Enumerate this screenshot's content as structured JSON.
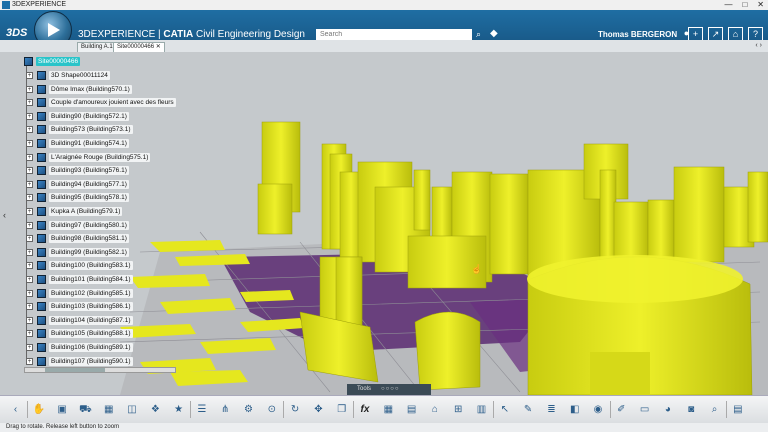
{
  "window": {
    "title": "3DEXPERIENCE",
    "controls": [
      "—",
      "□",
      "✕"
    ]
  },
  "app": {
    "logo": "3DS",
    "brand_prefix": "3DEXPERIENCE",
    "brand_separator": " | ",
    "brand_product": "CATIA",
    "brand_app": " Civil Engineering Design",
    "search_placeholder": "Search",
    "user_name": "Thomas BERGERON",
    "top_icons": [
      "user-icon",
      "add-icon",
      "share-icon",
      "home-icon",
      "help-icon"
    ]
  },
  "tabs": [
    {
      "label": "Building A.1"
    },
    {
      "label": "Site00000466",
      "close": "✕"
    }
  ],
  "tab_nav": "‹ ›",
  "tree": {
    "root": "Site00000466",
    "items": [
      "3D Shape00011124",
      "Dôme Imax (Building570.1)",
      "Couple d'amoureux jouient avec des fleurs",
      "Building90 (Building572.1)",
      "Building573 (Building573.1)",
      "Building91 (Building574.1)",
      "L'Araignée Rouge (Building575.1)",
      "Building93 (Building576.1)",
      "Building94 (Building577.1)",
      "Building95 (Building578.1)",
      "Kupka A (Building579.1)",
      "Building97 (Building580.1)",
      "Building98 (Building581.1)",
      "Building99 (Building582.1)",
      "Building100 (Building583.1)",
      "Building101 (Building584.1)",
      "Building102 (Building585.1)",
      "Building103 (Building586.1)",
      "Building104 (Building587.1)",
      "Building105 (Building588.1)",
      "Building106 (Building589.1)",
      "Building107 (Building590.1)"
    ]
  },
  "viewport": {
    "tools_label": "Tools",
    "tools_dots": "○○○○",
    "collapse_arrow": "‹"
  },
  "toolbar": {
    "icons": [
      "left-arrow-icon",
      "hand-icon",
      "cube-icon",
      "car-icon",
      "table-icon",
      "view-icon",
      "cube-group-icon",
      "star-icon",
      "list-icon",
      "tree-icon",
      "tree-settings-icon",
      "more-icon",
      "refresh-icon",
      "move-icon",
      "copy-icon",
      "formula-icon",
      "grid-icon",
      "frame-icon",
      "building-icon",
      "measure-icon",
      "chart-icon",
      "pointer-icon",
      "pen-icon",
      "layers-icon",
      "box-icon",
      "material-icon",
      "brush-icon",
      "eraser-icon",
      "paint-icon",
      "camera-icon",
      "inspect-icon",
      "save-icon"
    ],
    "formula_glyph": "fx"
  },
  "status": {
    "text": "Drag to rotate. Release left button to zoom"
  },
  "colors": {
    "app_bar": "#1f6ea3",
    "buildings": "#e6e81f",
    "ground": "#5a2a6e",
    "selection": "#29c4c9"
  }
}
